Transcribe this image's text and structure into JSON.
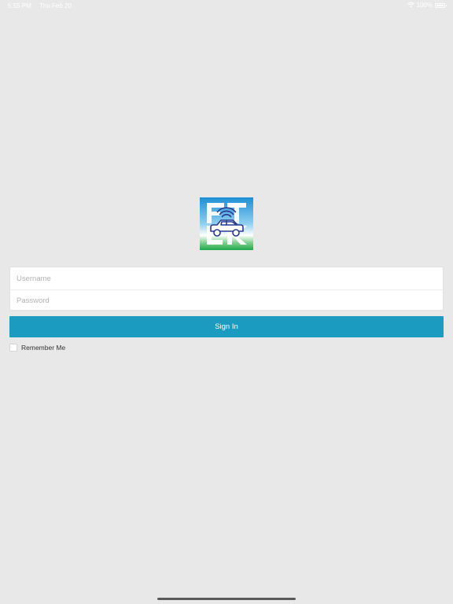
{
  "status_bar": {
    "time": "5:55 PM",
    "date": "Thu Feb 20",
    "battery": "100%",
    "wifi_icon": "wifi-icon",
    "battery_icon": "battery-icon"
  },
  "logo": {
    "icon": "car-signal-logo",
    "colors": {
      "blue": "#1e8fd4",
      "green": "#2aa850",
      "car": "#2b3a8f"
    }
  },
  "form": {
    "username_placeholder": "Username",
    "password_placeholder": "Password",
    "sign_in_label": "Sign In",
    "remember_me_label": "Remember Me",
    "remember_me_checked": false
  },
  "colors": {
    "accent": "#1b9bc0",
    "background": "#e8e8e8"
  }
}
